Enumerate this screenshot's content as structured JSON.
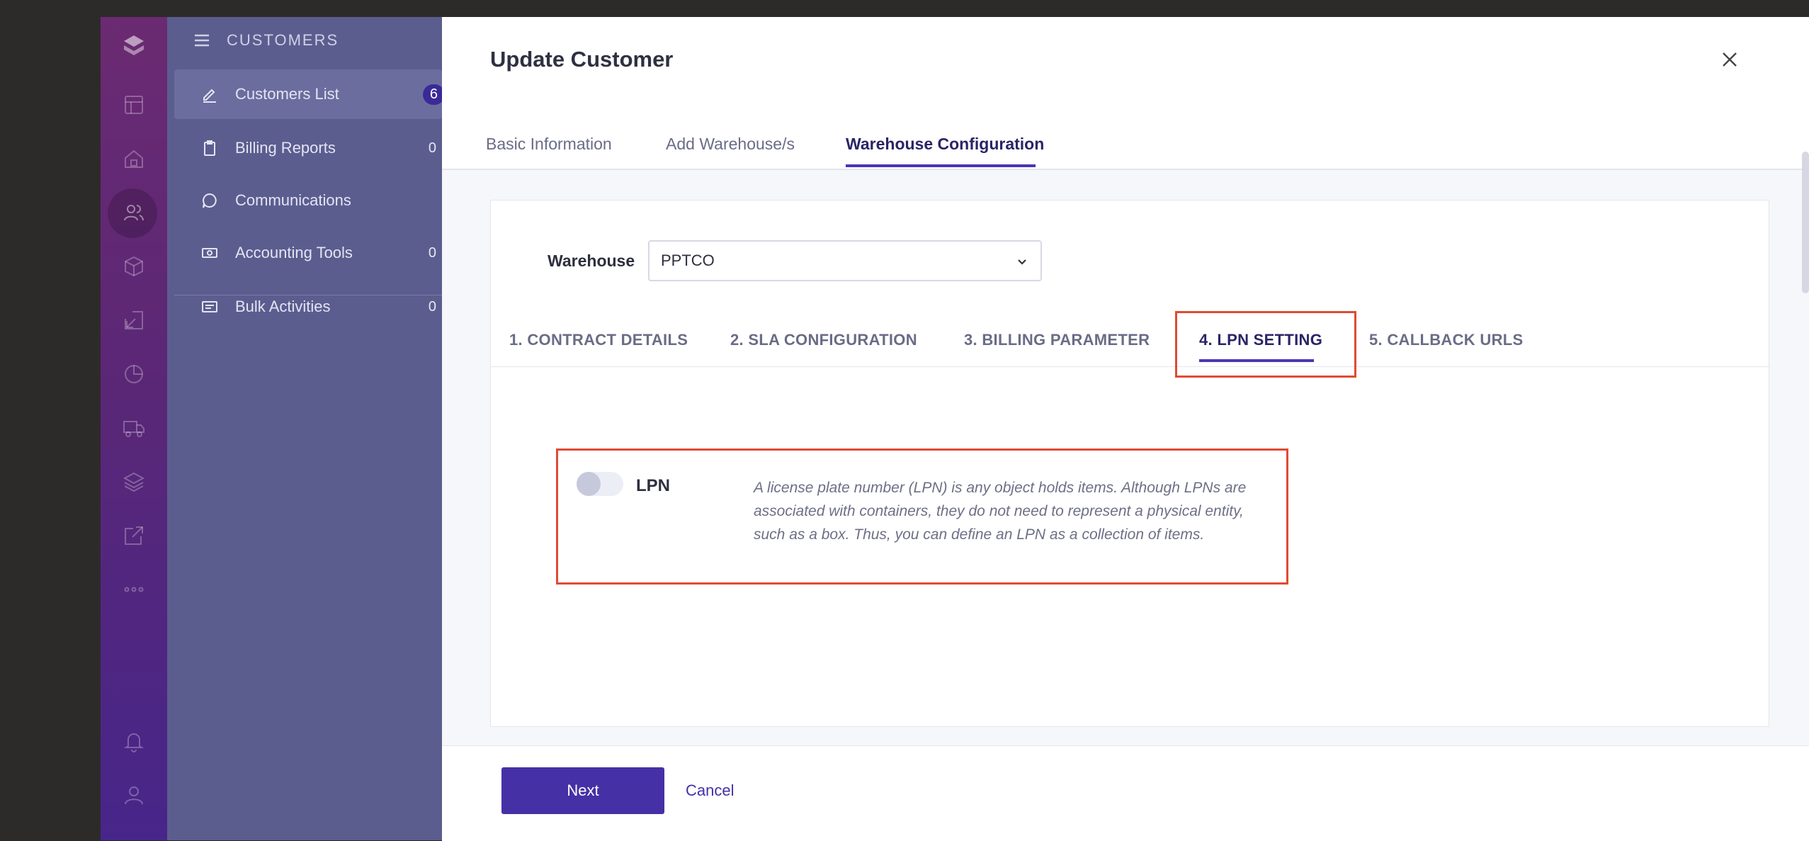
{
  "nav": {
    "title": "CUSTOMERS",
    "items": [
      {
        "label": "Customers List",
        "count": "6"
      },
      {
        "label": "Billing Reports",
        "count": "0"
      },
      {
        "label": "Communications",
        "count": ""
      },
      {
        "label": "Accounting Tools",
        "count": "0"
      },
      {
        "label": "Bulk Activities",
        "count": "0"
      }
    ]
  },
  "modal": {
    "title": "Update Customer",
    "tabs": [
      "Basic Information",
      "Add Warehouse/s",
      "Warehouse Configuration"
    ],
    "active_tab": "Warehouse Configuration"
  },
  "warehouse": {
    "label": "Warehouse",
    "value": "PPTCO"
  },
  "sub_tabs": [
    "1. CONTRACT DETAILS",
    "2. SLA CONFIGURATION",
    "3. BILLING PARAMETER",
    "4. LPN SETTING",
    "5. CALLBACK URLS"
  ],
  "active_sub_tab": "4. LPN SETTING",
  "lpn": {
    "label": "LPN",
    "enabled": false,
    "description": "A license plate number (LPN) is any object holds items. Although LPNs are associated with containers, they do not need to represent a physical entity, such as a box. Thus, you can define an LPN as a collection of items."
  },
  "footer": {
    "next_label": "Next",
    "cancel_label": "Cancel"
  },
  "colors": {
    "accent": "#4630a6",
    "highlight": "#e04b33",
    "rail_top": "#6b2a72",
    "rail_bottom": "#47268a"
  }
}
